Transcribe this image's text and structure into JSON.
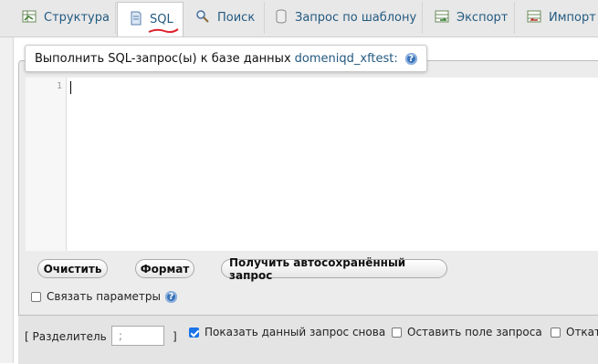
{
  "tabs": [
    {
      "label": "Структура",
      "icon": "structure-icon"
    },
    {
      "label": "SQL",
      "icon": "sql-icon",
      "active": true
    },
    {
      "label": "Поиск",
      "icon": "search-icon"
    },
    {
      "label": "Запрос по шаблону",
      "icon": "query-icon"
    },
    {
      "label": "Экспорт",
      "icon": "export-icon"
    },
    {
      "label": "Импорт",
      "icon": "import-icon"
    }
  ],
  "sql": {
    "legend_text": "Выполнить SQL-запрос(ы) к базе данных",
    "database_name": "domeniqd_xftest:",
    "line_number": "1",
    "editor_value": ""
  },
  "buttons": {
    "clear": "Очистить",
    "format": "Формат",
    "autosaved": "Получить автосохранённый запрос"
  },
  "bind_params": {
    "label": "Связать параметры",
    "checked": false
  },
  "bottom": {
    "delimiter_open": "[ Разделитель",
    "delimiter_value": ";",
    "delimiter_close": "]",
    "show_query_again": {
      "label": "Показать данный запрос снова",
      "checked": true
    },
    "keep_query_box": {
      "label": "Оставить поле запроса",
      "checked": false
    },
    "rollback": {
      "label": "Откат",
      "checked": false
    }
  },
  "colors": {
    "link": "#235a81",
    "accent": "#1a73e8",
    "underline": "#e0202a"
  }
}
